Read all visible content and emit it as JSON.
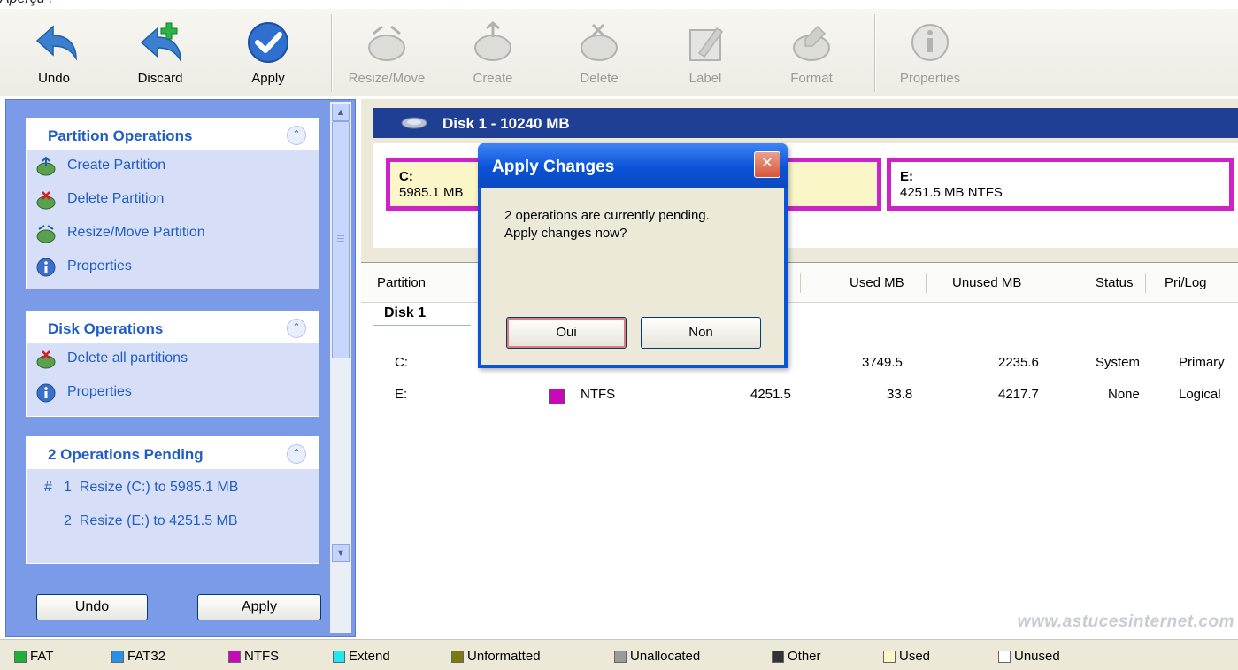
{
  "caption": "Aperçu :",
  "toolbar": {
    "undo": "Undo",
    "discard": "Discard",
    "apply": "Apply",
    "resize_move": "Resize/Move",
    "create": "Create",
    "delete": "Delete",
    "label": "Label",
    "format": "Format",
    "properties": "Properties"
  },
  "sidebar": {
    "partition_ops": {
      "title": "Partition Operations",
      "items": [
        "Create Partition",
        "Delete Partition",
        "Resize/Move Partition",
        "Properties"
      ]
    },
    "disk_ops": {
      "title": "Disk Operations",
      "items": [
        "Delete all partitions",
        "Properties"
      ]
    },
    "pending": {
      "title": "2 Operations Pending",
      "hash": "#",
      "ops": [
        "1  Resize (C:) to 5985.1 MB",
        "2  Resize (E:) to 4251.5 MB"
      ]
    },
    "undo_button": "Undo",
    "apply_button": "Apply"
  },
  "disk": {
    "header": "Disk 1 - 10240 MB",
    "partitions": [
      {
        "label": "C:",
        "detail": "5985.1 MB"
      },
      {
        "label": "E:",
        "detail": "4251.5 MB  NTFS"
      }
    ]
  },
  "table": {
    "headers": [
      "Partition",
      "Used MB",
      "Unused MB",
      "Status",
      "Pri/Log"
    ],
    "group": "Disk 1",
    "rows": [
      {
        "partition": "C:",
        "fs": "",
        "capacity": "",
        "used": "3749.5",
        "unused": "2235.6",
        "status": "System",
        "type": "Primary"
      },
      {
        "partition": "E:",
        "fs": "NTFS",
        "capacity": "4251.5",
        "used": "33.8",
        "unused": "4217.7",
        "status": "None",
        "type": "Logical"
      }
    ]
  },
  "legend": [
    {
      "label": "FAT",
      "color": "#1fb03a"
    },
    {
      "label": "FAT32",
      "color": "#2a8fe6"
    },
    {
      "label": "NTFS",
      "color": "#c60bb6"
    },
    {
      "label": "Extend",
      "color": "#22e6f0"
    },
    {
      "label": "Unformatted",
      "color": "#7a7a10"
    },
    {
      "label": "Unallocated",
      "color": "#9a9a9a"
    },
    {
      "label": "Other",
      "color": "#333333"
    },
    {
      "label": "Used",
      "color": "#fbf6c8"
    },
    {
      "label": "Unused",
      "color": "#ffffff"
    }
  ],
  "watermark": "www.astucesinternet.com",
  "dialog": {
    "title": "Apply Changes",
    "message": "2 operations are currently pending.\nApply changes now?",
    "yes": "Oui",
    "no": "Non"
  }
}
